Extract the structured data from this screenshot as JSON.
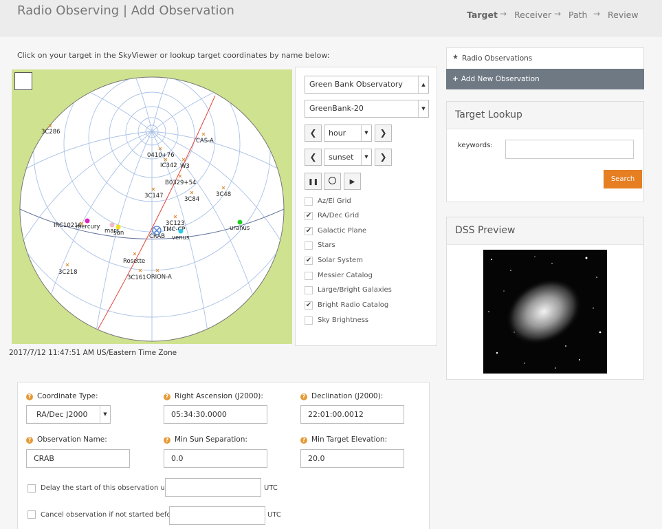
{
  "header": {
    "title": "Radio Observing | Add Observation",
    "steps": [
      "Target",
      "Receiver",
      "Path",
      "Review"
    ],
    "active_step": "Target",
    "arrow": "→"
  },
  "instructions": "Click on your target in the SkyViewer or lookup target coordinates by name below:",
  "sky": {
    "labels": [
      "3C286",
      "CAS-A",
      "0410+76",
      "IC342",
      "W3",
      "B0329+54",
      "3C147",
      "3C84",
      "3C48",
      "IRC10216",
      "mercury",
      "mars",
      "sun",
      "3C123",
      "TMC-CP",
      "CRAB",
      "venus",
      "uranus",
      "Rosette",
      "3C218",
      "3C161",
      "ORION-A"
    ]
  },
  "controls": {
    "observatory": "Green Bank Observatory",
    "telescope": "GreenBank-20",
    "step_unit": "hour",
    "event": "sunset",
    "options": [
      {
        "label": "Az/El Grid",
        "checked": false
      },
      {
        "label": "RA/Dec Grid",
        "checked": true
      },
      {
        "label": "Galactic Plane",
        "checked": true
      },
      {
        "label": "Stars",
        "checked": false
      },
      {
        "label": "Solar System",
        "checked": true
      },
      {
        "label": "Messier Catalog",
        "checked": false
      },
      {
        "label": "Large/Bright Galaxies",
        "checked": false
      },
      {
        "label": "Bright Radio Catalog",
        "checked": true
      },
      {
        "label": "Sky Brightness",
        "checked": false
      }
    ]
  },
  "timestamp": "2017/7/12 11:47:51 AM US/Eastern Time Zone",
  "sidebar": {
    "radio_observations": "Radio Observations",
    "add_new": "Add New Observation",
    "target_lookup": {
      "title": "Target Lookup",
      "keywords_label": "keywords:",
      "keywords_value": "",
      "search_label": "Search"
    },
    "dss_title": "DSS Preview"
  },
  "form": {
    "coordinate_type": {
      "label": "Coordinate Type:",
      "value": "RA/Dec J2000"
    },
    "ra": {
      "label": "Right Ascension (J2000):",
      "value": "05:34:30.0000"
    },
    "dec": {
      "label": "Declination (J2000):",
      "value": "22:01:00.0012"
    },
    "name": {
      "label": "Observation Name:",
      "value": "CRAB"
    },
    "min_sun": {
      "label": "Min Sun Separation:",
      "value": "0.0"
    },
    "min_elev": {
      "label": "Min Target Elevation:",
      "value": "20.0"
    },
    "delay": {
      "label": "Delay the start of this observation until",
      "value": "",
      "unit": "UTC"
    },
    "cancel": {
      "label": "Cancel observation if not started before",
      "value": "",
      "unit": "UTC"
    }
  },
  "colors": {
    "accent": "#e67e22",
    "sky_bg": "#cfe28f",
    "grid": "#a9c1e6",
    "galactic": "#e2463c"
  }
}
